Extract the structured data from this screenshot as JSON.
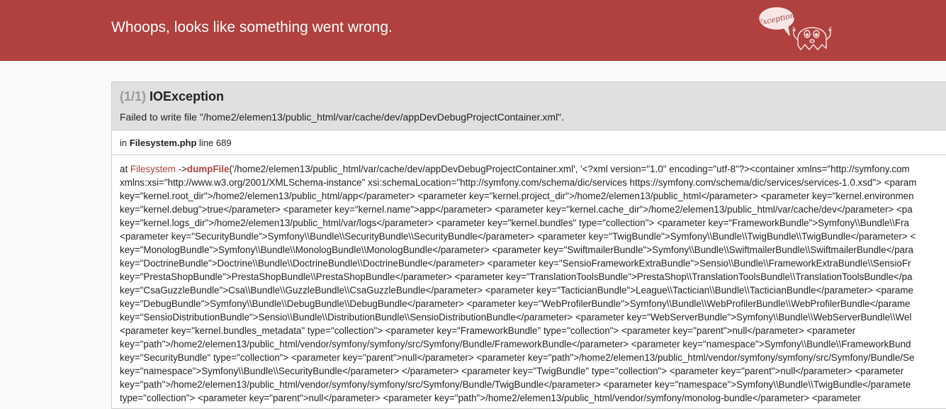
{
  "header": {
    "title": "Whoops, looks like something went wrong.",
    "logo_text": "Exception!"
  },
  "exception": {
    "count": "(1/1)",
    "class": "IOException",
    "message": "Failed to write file \"/home2/elemen13/public_html/var/cache/dev/appDevDebugProjectContainer.xml\"."
  },
  "location": {
    "prefix": "in",
    "file": "Filesystem.php",
    "line_label": "line 689"
  },
  "trace": {
    "at": "at",
    "class": "Filesystem",
    "arrow": "->",
    "function": "dumpFile",
    "first_args": "('/home2/elemen13/public_html/var/cache/dev/appDevDebugProjectContainer.xml', '<?xml version=\"1.0\" encoding=\"utf-8\"?><container xmlns=\"http://symfony.com",
    "lines": [
      "xmlns:xsi=\"http://www.w3.org/2001/XMLSchema-instance\" xsi:schemaLocation=\"http://symfony.com/schema/dic/services https://symfony.com/schema/dic/services/services-1.0.xsd\"> <param",
      "key=\"kernel.root_dir\">/home2/elemen13/public_html/app</parameter> <parameter key=\"kernel.project_dir\">/home2/elemen13/public_html</parameter> <parameter key=\"kernel.environmen",
      "key=\"kernel.debug\">true</parameter> <parameter key=\"kernel.name\">app</parameter> <parameter key=\"kernel.cache_dir\">/home2/elemen13/public_html/var/cache/dev</parameter> <pa",
      "key=\"kernel.logs_dir\">/home2/elemen13/public_html/var/logs</parameter> <parameter key=\"kernel.bundles\" type=\"collection\"> <parameter key=\"FrameworkBundle\">Symfony\\\\Bundle\\\\Fra",
      "<parameter key=\"SecurityBundle\">Symfony\\\\Bundle\\\\SecurityBundle\\\\SecurityBundle</parameter> <parameter key=\"TwigBundle\">Symfony\\\\Bundle\\\\TwigBundle\\\\TwigBundle</parameter> <",
      "key=\"MonologBundle\">Symfony\\\\Bundle\\\\MonologBundle\\\\MonologBundle</parameter> <parameter key=\"SwiftmailerBundle\">Symfony\\\\Bundle\\\\SwiftmailerBundle\\\\SwiftmailerBundle</para",
      "key=\"DoctrineBundle\">Doctrine\\\\Bundle\\\\DoctrineBundle\\\\DoctrineBundle</parameter> <parameter key=\"SensioFrameworkExtraBundle\">Sensio\\\\Bundle\\\\FrameworkExtraBundle\\\\SensioFr",
      "key=\"PrestaShopBundle\">PrestaShopBundle\\\\PrestaShopBundle</parameter> <parameter key=\"TranslationToolsBundle\">PrestaShop\\\\TranslationToolsBundle\\\\TranslationToolsBundle</pa",
      "key=\"CsaGuzzleBundle\">Csa\\\\Bundle\\\\GuzzleBundle\\\\CsaGuzzleBundle</parameter> <parameter key=\"TacticianBundle\">League\\\\Tactician\\\\Bundle\\\\TacticianBundle</parameter> <parame",
      "key=\"DebugBundle\">Symfony\\\\Bundle\\\\DebugBundle\\\\DebugBundle</parameter> <parameter key=\"WebProfilerBundle\">Symfony\\\\Bundle\\\\WebProfilerBundle\\\\WebProfilerBundle</parame",
      "key=\"SensioDistributionBundle\">Sensio\\\\Bundle\\\\DistributionBundle\\\\SensioDistributionBundle</parameter> <parameter key=\"WebServerBundle\">Symfony\\\\Bundle\\\\WebServerBundle\\\\Wel",
      "<parameter key=\"kernel.bundles_metadata\" type=\"collection\"> <parameter key=\"FrameworkBundle\" type=\"collection\"> <parameter key=\"parent\">null</parameter> <parameter",
      "key=\"path\">/home2/elemen13/public_html/vendor/symfony/symfony/src/Symfony/Bundle/FrameworkBundle</parameter> <parameter key=\"namespace\">Symfony\\\\Bundle\\\\FrameworkBund",
      "key=\"SecurityBundle\" type=\"collection\"> <parameter key=\"parent\">null</parameter> <parameter key=\"path\">/home2/elemen13/public_html/vendor/symfony/symfony/src/Symfony/Bundle/Se",
      "key=\"namespace\">Symfony\\\\Bundle\\\\SecurityBundle</parameter> </parameter> <parameter key=\"TwigBundle\" type=\"collection\"> <parameter key=\"parent\">null</parameter> <parameter",
      "key=\"path\">/home2/elemen13/public_html/vendor/symfony/symfony/src/Symfony/Bundle/TwigBundle</parameter> <parameter key=\"namespace\">Symfony\\\\Bundle\\\\TwigBundle</paramete",
      "type=\"collection\"> <parameter key=\"parent\">null</parameter> <parameter key=\"path\">/home2/elemen13/public_html/vendor/symfony/monolog-bundle</parameter> <parameter"
    ]
  },
  "colors": {
    "header_bg": "#b0413e",
    "accent": "#b0413e",
    "panel_head_bg": "#e0e0e0"
  }
}
